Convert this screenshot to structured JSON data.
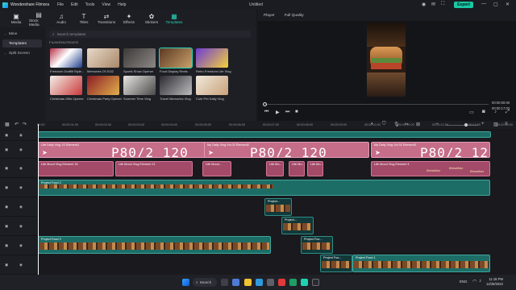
{
  "app": {
    "name": "Wondershare Filmora",
    "menu": [
      "File",
      "Edit",
      "Tools",
      "View",
      "Help"
    ],
    "doc_title": "Untitled",
    "export_label": "Export"
  },
  "media_tabs": [
    {
      "label": "Media",
      "icon": "media-icon"
    },
    {
      "label": "Stock Media",
      "icon": "stock-media-icon"
    },
    {
      "label": "Audio",
      "icon": "music-note-icon"
    },
    {
      "label": "Titles",
      "icon": "text-T-icon"
    },
    {
      "label": "Transitions",
      "icon": "transition-icon"
    },
    {
      "label": "Effects",
      "icon": "effects-icon"
    },
    {
      "label": "Stickers",
      "icon": "sticker-icon"
    },
    {
      "label": "Templates",
      "icon": "templates-icon"
    }
  ],
  "sidebar": {
    "items": [
      {
        "label": "Mine"
      },
      {
        "label": "Templates"
      },
      {
        "label": "Split Screen"
      }
    ]
  },
  "browser": {
    "search_placeholder": "Search templates",
    "category": "FILMORACREATE",
    "templates": [
      {
        "title": "Freedom Graffiti Style..."
      },
      {
        "title": "Memories Of 2022"
      },
      {
        "title": "Sports Show Opener"
      },
      {
        "title": "Food Display Reels"
      },
      {
        "title": "Retro Freedom Life Vlog"
      },
      {
        "title": "Christmas Gifts Opener"
      },
      {
        "title": "Christmas Party Opener"
      },
      {
        "title": "Summer Time Vlog"
      },
      {
        "title": "Travel Memories Vlog"
      },
      {
        "title": "Cute Pet Daily Vlog"
      }
    ]
  },
  "player": {
    "label": "Player",
    "quality": "Full Quality",
    "time_current": "00:00:00:00",
    "time_total": "00:00:17:03"
  },
  "ruler": [
    "00:00",
    "00:00:01:00",
    "00:00:02:00",
    "00:00:03:00",
    "00:00:04:00",
    "00:00:05:00",
    "00:00:06:00",
    "00:00:07:00",
    "00:00:08:00",
    "00:00:09:00",
    "00:00:10:00",
    "00:00:11:00",
    "00:00:12:00",
    "00:00:13:00",
    "00:00:14:00"
  ],
  "clips": {
    "title_a": "Life Daily Vlog V2 Element1",
    "title_b": "My Daily Vlog Vol 02 Element2",
    "title_c": "My Daily Vlog Vol 02 Element3",
    "big_text": "P80/2 120",
    "sub_a": "Life Mood Vlog Element 16",
    "sub_b": "Life Mood Vlog Element 21",
    "sub_c": "Life Mood...",
    "sub_d": "Life Mo...",
    "sub_e": "Life Mood Vlog Element 4",
    "breakfast": "Breakfast",
    "video_main": "Project Food 2",
    "video_small_a": "Project...",
    "video_small_b": "Project Foo...",
    "video_long_a": "Project Food 2",
    "video_long_b": "Project Food 1"
  },
  "taskbar": {
    "search_label": "Search",
    "time": "11:18 PM",
    "date": "12/28/2022",
    "lang": "ENG"
  }
}
